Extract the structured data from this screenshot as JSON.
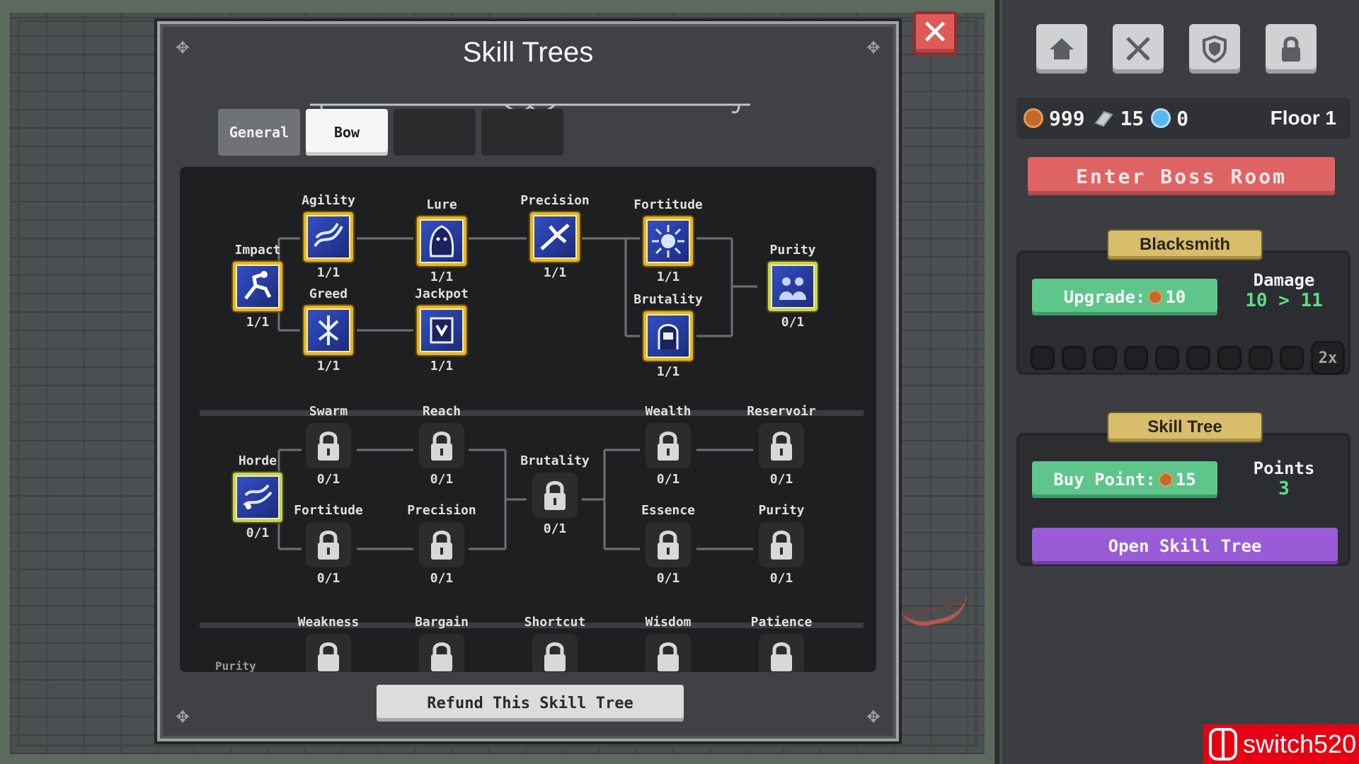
{
  "panel": {
    "title": "Skill Trees",
    "tabs": [
      {
        "label": "General"
      },
      {
        "label": "Bow"
      },
      {
        "label": ""
      },
      {
        "label": ""
      }
    ],
    "refund_label": "Refund This Skill Tree",
    "cut_off_label": "Purity"
  },
  "tree": {
    "row1": [
      {
        "name": "Impact",
        "count": "1/1"
      },
      {
        "name": "Agility",
        "count": "1/1"
      },
      {
        "name": "Greed",
        "count": "1/1"
      },
      {
        "name": "Lure",
        "count": "1/1"
      },
      {
        "name": "Jackpot",
        "count": "1/1"
      },
      {
        "name": "Precision",
        "count": "1/1"
      },
      {
        "name": "Fortitude",
        "count": "1/1"
      },
      {
        "name": "Brutality",
        "count": "1/1"
      },
      {
        "name": "Purity",
        "count": "0/1"
      }
    ],
    "row2": [
      {
        "name": "Horde",
        "count": "0/1"
      },
      {
        "name": "Swarm",
        "count": "0/1"
      },
      {
        "name": "Fortitude",
        "count": "0/1"
      },
      {
        "name": "Reach",
        "count": "0/1"
      },
      {
        "name": "Precision",
        "count": "0/1"
      },
      {
        "name": "Brutality",
        "count": "0/1"
      },
      {
        "name": "Wealth",
        "count": "0/1"
      },
      {
        "name": "Essence",
        "count": "0/1"
      },
      {
        "name": "Reservoir",
        "count": "0/1"
      },
      {
        "name": "Purity",
        "count": "0/1"
      }
    ],
    "row3": [
      {
        "name": "Weakness"
      },
      {
        "name": "Bargain"
      },
      {
        "name": "Shortcut"
      },
      {
        "name": "Wisdom"
      },
      {
        "name": "Patience"
      }
    ]
  },
  "sidebar": {
    "top_icons": [
      "home-icon",
      "crossed-swords-icon",
      "shield-icon",
      "lock-icon"
    ],
    "stats": {
      "coins": "999",
      "scrap": "15",
      "gems": "0",
      "floor": "Floor 1"
    },
    "boss_label": "Enter Boss Room",
    "blacksmith": {
      "title": "Blacksmith",
      "upgrade_label": "Upgrade:",
      "upgrade_cost": "10",
      "damage_label": "Damage",
      "damage_value": "10 > 11",
      "multiplier": "2x"
    },
    "skilltree": {
      "title": "Skill Tree",
      "buy_label": "Buy Point:",
      "buy_cost": "15",
      "points_label": "Points",
      "points_value": "3",
      "open_label": "Open Skill Tree"
    }
  },
  "watermark": "switch520",
  "colors": {
    "node_border": "#e3b52d",
    "boss_button": "#e06363",
    "green_button": "#5ec58b",
    "purple_button": "#9a5cd6",
    "value_green": "#5fdc86"
  }
}
